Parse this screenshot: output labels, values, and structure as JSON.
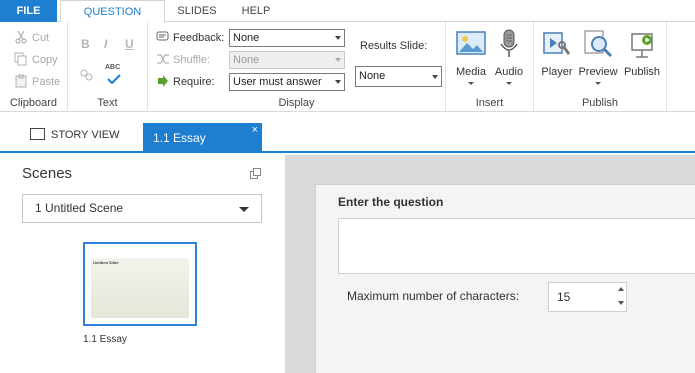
{
  "ribbon_tabs": {
    "file": "FILE",
    "question": "QUESTION",
    "slides": "SLIDES",
    "help": "HELP"
  },
  "clipboard": {
    "cut": "Cut",
    "copy": "Copy",
    "paste": "Paste",
    "label": "Clipboard"
  },
  "text_group": {
    "bold": "B",
    "italic": "I",
    "underline": "U",
    "spell": "ABC",
    "label": "Text"
  },
  "display": {
    "feedback_label": "Feedback:",
    "feedback_value": "None",
    "shuffle_label": "Shuffle:",
    "shuffle_value": "None",
    "require_label": "Require:",
    "require_value": "User must answer",
    "results_label": "Results Slide:",
    "results_value": "None",
    "label": "Display"
  },
  "insert": {
    "media": "Media",
    "audio": "Audio",
    "label": "Insert"
  },
  "publish": {
    "player": "Player",
    "preview": "Preview",
    "publish": "Publish",
    "label": "Publish"
  },
  "doc_tabs": {
    "story_view": "STORY VIEW",
    "essay": "1.1 Essay",
    "close": "×"
  },
  "scenes": {
    "title": "Scenes",
    "selected_scene": "1 Untitled Scene",
    "thumbnail_text": "Untitled Slide",
    "slide_label": "1.1 Essay"
  },
  "editor": {
    "question_label": "Enter the question",
    "question_value": "",
    "max_chars_label": "Maximum number of characters:",
    "max_chars_value": "15"
  },
  "colors": {
    "accent": "#1e7fd1",
    "work_area_bg": "#dadada"
  }
}
